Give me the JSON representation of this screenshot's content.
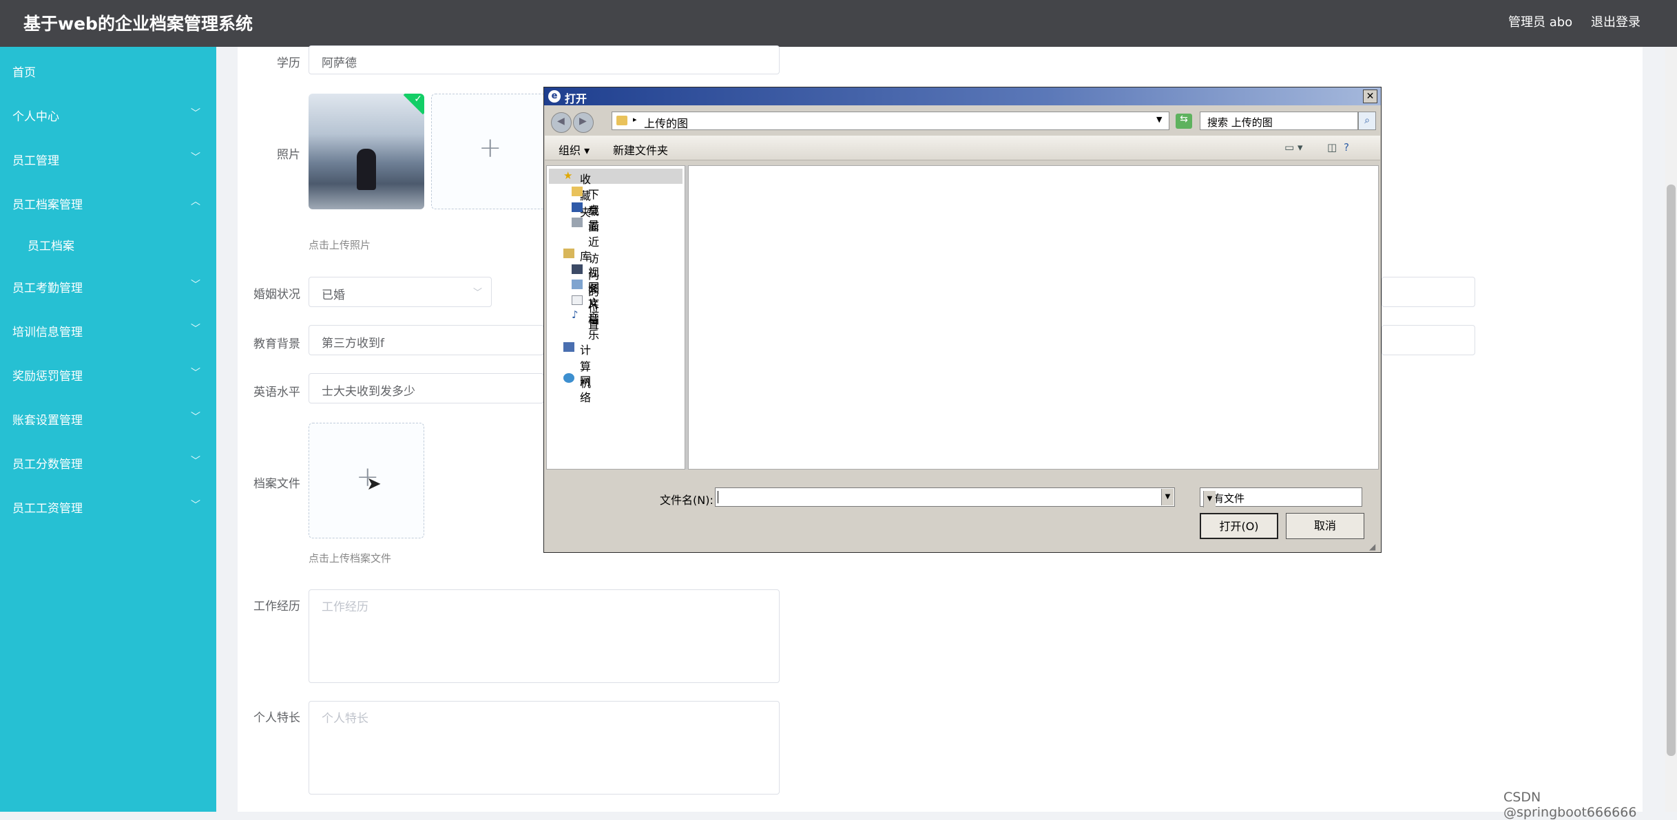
{
  "header": {
    "title": "基于web的企业档案管理系统",
    "user": "管理员 abo",
    "logout": "退出登录"
  },
  "sidebar": {
    "items": [
      {
        "label": "首页",
        "chevron": ""
      },
      {
        "label": "个人中心",
        "chevron": "﹀"
      },
      {
        "label": "员工管理",
        "chevron": "﹀"
      },
      {
        "label": "员工档案管理",
        "chevron": "︿"
      },
      {
        "label": "员工档案",
        "chevron": ""
      },
      {
        "label": "员工考勤管理",
        "chevron": "﹀"
      },
      {
        "label": "培训信息管理",
        "chevron": "﹀"
      },
      {
        "label": "奖励惩罚管理",
        "chevron": "﹀"
      },
      {
        "label": "账套设置管理",
        "chevron": "﹀"
      },
      {
        "label": "员工分数管理",
        "chevron": "﹀"
      },
      {
        "label": "员工工资管理",
        "chevron": "﹀"
      }
    ]
  },
  "form": {
    "education_label": "学历",
    "education_value": "阿萨德",
    "photo_label": "照片",
    "photo_hint": "点击上传照片",
    "marital_label": "婚姻状况",
    "marital_value": "已婚",
    "edu_bg_label": "教育背景",
    "edu_bg_value": "第三方收到f",
    "english_label": "英语水平",
    "english_value": "士大夫收到发多少",
    "archive_label": "档案文件",
    "archive_hint": "点击上传档案文件",
    "work_label": "工作经历",
    "work_placeholder": "工作经历",
    "skill_label": "个人特长",
    "skill_placeholder": "个人特长",
    "plus": "+"
  },
  "dialog": {
    "title": "打开",
    "close": "✕",
    "path": "上传的图",
    "search_placeholder": "搜索 上传的图",
    "organize": "组织 ▾",
    "new_folder": "新建文件夹",
    "nav": [
      {
        "label": "收藏夹",
        "icon": "star"
      },
      {
        "label": "下载",
        "icon": "folder"
      },
      {
        "label": "桌面",
        "icon": "desktop"
      },
      {
        "label": "最近访问的位置",
        "icon": "recent"
      },
      {
        "label": "库",
        "icon": "library"
      },
      {
        "label": "视频",
        "icon": "video"
      },
      {
        "label": "图片",
        "icon": "picture"
      },
      {
        "label": "文档",
        "icon": "document"
      },
      {
        "label": "音乐",
        "icon": "music"
      },
      {
        "label": "计算机",
        "icon": "computer"
      },
      {
        "label": "网络",
        "icon": "network"
      }
    ],
    "filename_label": "文件名(N):",
    "filetype_value": "所有文件",
    "open_button": "打开(O)",
    "cancel_button": "取消"
  },
  "watermark": "CSDN @springboot666666",
  "colors": {
    "sidebar": "#26c0d3",
    "topbar": "#444549",
    "dialog_title": "#1f3f8f"
  }
}
